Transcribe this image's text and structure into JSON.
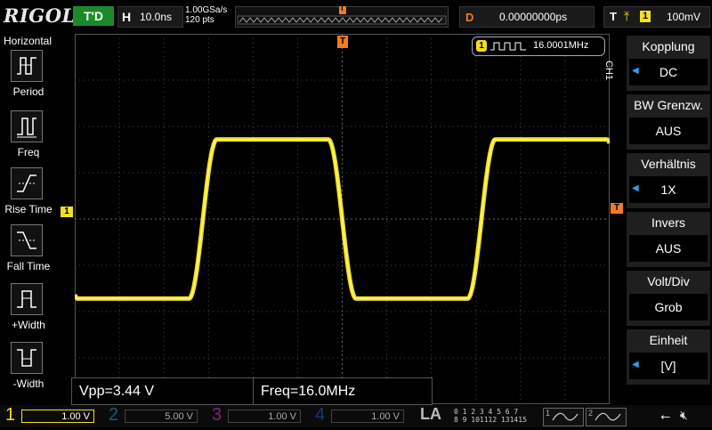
{
  "top": {
    "brand": "RIGOL",
    "run_state": "T'D",
    "timebase_label": "H",
    "timebase_value": "10.0ns",
    "sample_rate": "1.00GSa/s",
    "memory_points": "120 pts",
    "trigger_marker": "T",
    "delay_label": "D",
    "delay_value": "0.00000000ps",
    "trigger_label": "T",
    "trigger_source": "1",
    "trigger_level": "100mV"
  },
  "left_menu": {
    "title": "Horizontal",
    "items": [
      {
        "label": "Period",
        "icon": "period-measure-icon"
      },
      {
        "label": "Freq",
        "icon": "frequency-measure-icon"
      },
      {
        "label": "Rise Time",
        "icon": "rise-time-icon"
      },
      {
        "label": "Fall Time",
        "icon": "fall-time-icon"
      },
      {
        "label": "+Width",
        "icon": "positive-width-icon"
      },
      {
        "label": "-Width",
        "icon": "negative-width-icon"
      }
    ]
  },
  "screen": {
    "ch1_ground_marker": "1",
    "trigger_level_marker": "T",
    "freq_counter_channel": "1",
    "freq_counter_value": "16.0001MHz",
    "side_channel": "CH1"
  },
  "right_menu": [
    {
      "title": "Kopplung",
      "value": "DC",
      "arrow": true
    },
    {
      "title": "BW Grenzw.",
      "value": "AUS",
      "arrow": false
    },
    {
      "title": "Verhältnis",
      "value": "1X",
      "arrow": true
    },
    {
      "title": "Invers",
      "value": "AUS",
      "arrow": false
    },
    {
      "title": "Volt/Div",
      "value": "Grob",
      "arrow": false
    },
    {
      "title": "Einheit",
      "value": "[V]",
      "arrow": true
    }
  ],
  "measurements": [
    {
      "label": "Vpp=3.44 V"
    },
    {
      "label": "Freq=16.0MHz"
    }
  ],
  "bottom": {
    "channels": [
      {
        "num": "1",
        "scale": "1.00 V",
        "active": true
      },
      {
        "num": "2",
        "scale": "5.00 V",
        "active": false
      },
      {
        "num": "3",
        "scale": "1.00 V",
        "active": false
      },
      {
        "num": "4",
        "scale": "1.00 V",
        "active": false
      }
    ],
    "la": "LA",
    "digital_bits_top": "0 1 2 3  4 5 6 7",
    "digital_bits_bottom": "8 9 101112  131415",
    "gen1": "1",
    "gen2": "2"
  },
  "colors": {
    "ch1": "#f0e020",
    "trigger": "#f47a1f",
    "accent_blue": "#2aa0ff",
    "running_green": "#1c8a2a"
  },
  "waveform": {
    "frequency_mhz": 16.0,
    "vpp_v": 3.44,
    "volts_per_div": 1.0,
    "time_per_div_ns": 10.0
  }
}
